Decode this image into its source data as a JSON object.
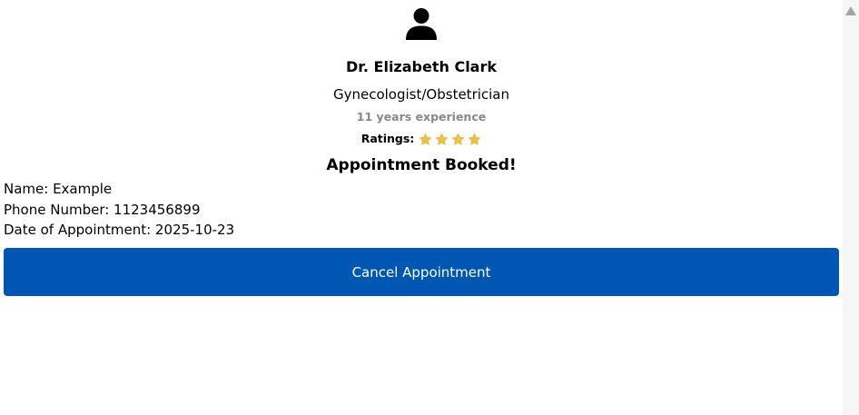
{
  "doctor": {
    "name": "Dr. Elizabeth Clark",
    "specialty": "Gynecologist/Obstetrician",
    "experience": "11 years experience",
    "ratings_label": "Ratings:",
    "rating_stars": 4,
    "star_color": "#f0c238",
    "avatar_icon": "user-icon"
  },
  "booking": {
    "title": "Appointment Booked!",
    "name_line": "Name: Example",
    "phone_line": "Phone Number: 1123456899",
    "date_line": "Date of Appointment: 2025-10-23"
  },
  "actions": {
    "cancel_label": "Cancel Appointment",
    "cancel_color": "#0057b3"
  }
}
